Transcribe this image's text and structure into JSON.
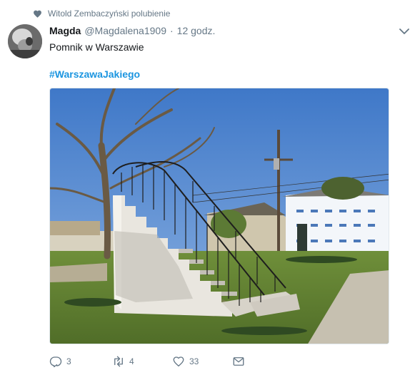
{
  "social_context": {
    "text": "Witold Zembaczyński polubienie",
    "icon": "heart-icon"
  },
  "author": {
    "name": "Magda",
    "handle": "@Magdalena1909",
    "separator": "·",
    "time": "12 godz."
  },
  "tweet": {
    "text": "Pomnik w Warszawie",
    "hashtag": "#WarszawaJakiego"
  },
  "media": {
    "icon": "photo-stairs-to-nowhere"
  },
  "actions": {
    "reply": {
      "icon": "reply-icon",
      "count": "3"
    },
    "retweet": {
      "icon": "retweet-icon",
      "count": "4"
    },
    "like": {
      "icon": "heart-outline-icon",
      "count": "33"
    },
    "message": {
      "icon": "envelope-icon"
    }
  },
  "colors": {
    "link": "#1b95e0",
    "muted": "#657786",
    "text": "#14171a"
  }
}
